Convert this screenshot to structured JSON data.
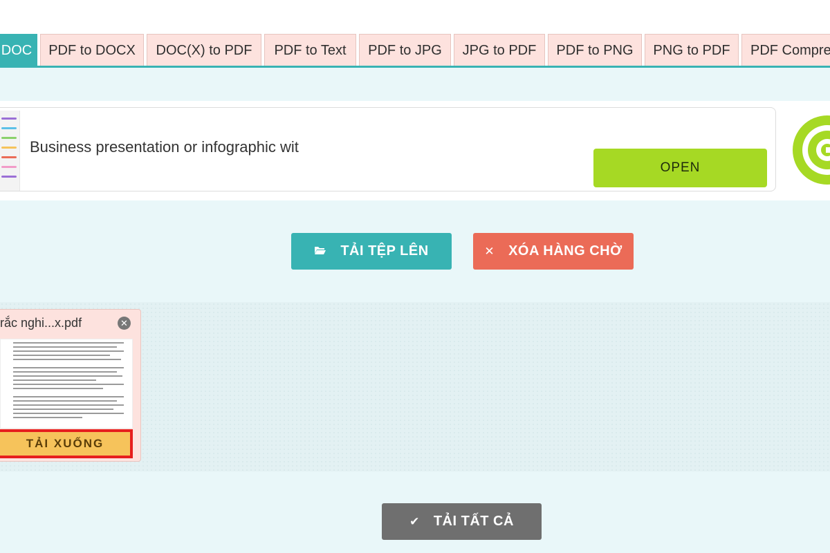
{
  "tabs": [
    {
      "label": "DOC",
      "active": true
    },
    {
      "label": "PDF to DOCX",
      "active": false
    },
    {
      "label": "DOC(X) to PDF",
      "active": false
    },
    {
      "label": "PDF to Text",
      "active": false
    },
    {
      "label": "PDF to JPG",
      "active": false
    },
    {
      "label": "JPG to PDF",
      "active": false
    },
    {
      "label": "PDF to PNG",
      "active": false
    },
    {
      "label": "PNG to PDF",
      "active": false
    },
    {
      "label": "PDF Compre",
      "active": false
    }
  ],
  "ad": {
    "text": "Business presentation or infographic wit",
    "open_label": "OPEN"
  },
  "actions": {
    "upload_label": "TẢI TỆP LÊN",
    "clear_label": "XÓA HÀNG CHỜ",
    "download_all_label": "TẢI TẤT CẢ"
  },
  "file": {
    "name": "rắc nghi...x.pdf",
    "download_label": "TẢI XUỐNG"
  },
  "colors": {
    "accent": "#38b3b3",
    "clear": "#eb6b57",
    "download_all": "#6f6f6f",
    "download": "#f6c35b",
    "highlight": "#e61e1e",
    "ad_open": "#a6d924"
  },
  "icons": {
    "upload": "folder-open-icon",
    "clear": "close-icon",
    "download_all": "check-icon",
    "file_remove": "close-circle-icon"
  }
}
